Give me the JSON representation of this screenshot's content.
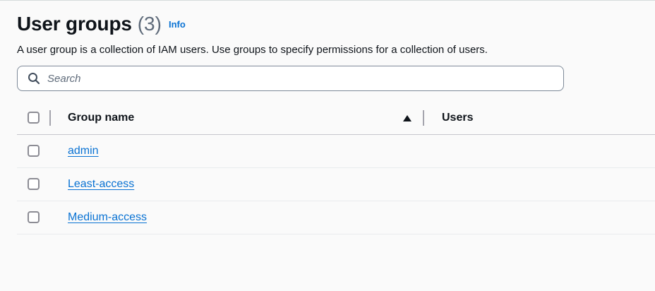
{
  "header": {
    "title": "User groups",
    "count": "(3)",
    "info_label": "Info"
  },
  "description": "A user group is a collection of IAM users. Use groups to specify permissions for a collection of users.",
  "search": {
    "placeholder": "Search",
    "value": "",
    "icon": "search-icon"
  },
  "table": {
    "columns": [
      "Group name",
      "Users"
    ],
    "sort": {
      "column": "Group name",
      "direction": "ascending",
      "icon": "sort-ascending-icon"
    },
    "rows": [
      {
        "group_name": "admin",
        "users": ""
      },
      {
        "group_name": "Least-access",
        "users": ""
      },
      {
        "group_name": "Medium-access",
        "users": ""
      }
    ]
  },
  "colors": {
    "link": "#0972d3",
    "text": "#0f141a",
    "muted": "#5f6b7a",
    "background": "#fafafa"
  }
}
